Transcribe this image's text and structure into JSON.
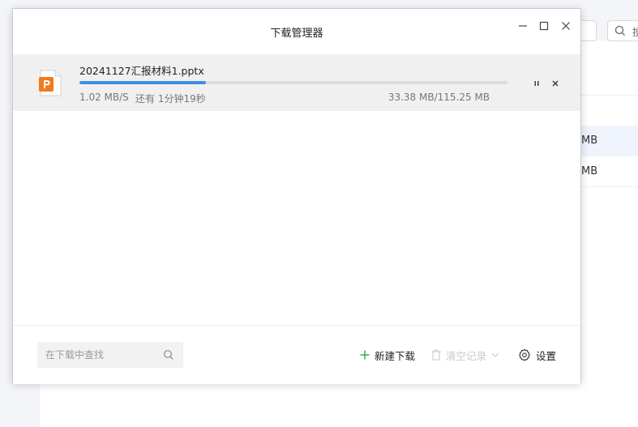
{
  "background": {
    "search_hint": "搜",
    "rows": [
      {
        "size": "MB"
      },
      {
        "size": "MB"
      }
    ]
  },
  "dialog": {
    "title": "下载管理器",
    "window_controls": {
      "minimize": "minimize-icon",
      "maximize": "maximize-icon",
      "close": "close-icon"
    }
  },
  "download": {
    "file_name": "20241127汇报材料1.pptx",
    "file_type_icon": "pptx-file-icon",
    "speed": "1.02 MB/S",
    "remaining": "还有 1分钟19秒",
    "size": "33.38 MB/115.25 MB",
    "progress_percent": 29.5,
    "accent_color": "#3d8fe6",
    "icon_color": "#f07b1d"
  },
  "footer": {
    "search_placeholder": "在下载中查找",
    "new_download_label": "新建下载",
    "clear_records_label": "清空记录",
    "settings_label": "设置"
  }
}
